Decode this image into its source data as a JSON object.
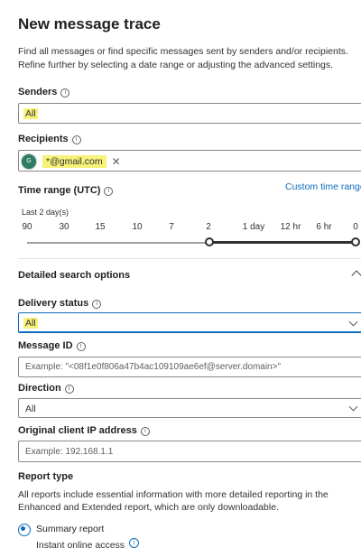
{
  "page": {
    "title": "New message trace",
    "intro": "Find all messages or find specific messages sent by senders and/or recipients. Refine further by selecting a date range or adjusting the advanced settings."
  },
  "senders": {
    "label": "Senders",
    "value": "All"
  },
  "recipients": {
    "label": "Recipients",
    "chip_initial": "G",
    "chip_text": "*@gmail.com",
    "remove_glyph": "✕"
  },
  "time_range": {
    "label": "Time range (UTC)",
    "custom_link": "Custom time range",
    "current": "Last 2 day(s)",
    "ticks": [
      "90",
      "30",
      "15",
      "10",
      "7",
      "2",
      "1 day",
      "12 hr",
      "6 hr",
      "0"
    ]
  },
  "detailed": {
    "label": "Detailed search options"
  },
  "delivery_status": {
    "label": "Delivery status",
    "value": "All"
  },
  "message_id": {
    "label": "Message ID",
    "placeholder": "Example: \"<08f1e0f806a47b4ac109109ae6ef@server.domain>\""
  },
  "direction": {
    "label": "Direction",
    "value": "All"
  },
  "client_ip": {
    "label": "Original client IP address",
    "placeholder": "Example: 192.168.1.1"
  },
  "report_type": {
    "label": "Report type",
    "description": "All reports include essential information with more detailed reporting in the Enhanced and Extended report, which are only downloadable.",
    "option_label": "Summary report",
    "option_sub": "Instant online access",
    "selected": true
  },
  "colors": {
    "accent": "#0f6cbd",
    "highlight": "#f6f27a",
    "avatar": "#2e7d62"
  }
}
